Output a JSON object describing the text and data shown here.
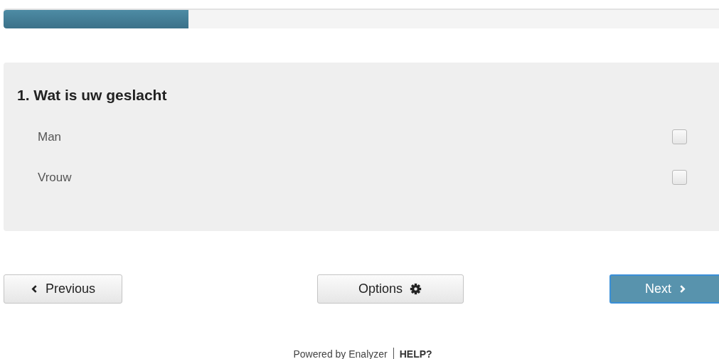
{
  "progress": {
    "level": 0.254
  },
  "question": {
    "title": "1. Wat is uw geslacht",
    "options": [
      {
        "label": "Man",
        "checked": false
      },
      {
        "label": "Vrouw",
        "checked": false
      }
    ]
  },
  "buttons": [
    {
      "kind": "previous",
      "label": "Previous"
    },
    {
      "kind": "options",
      "label": "Options"
    },
    {
      "kind": "next",
      "label": "Next"
    }
  ],
  "footer": {
    "powered": "Powered by Enalyzer",
    "help": "HELP?"
  }
}
